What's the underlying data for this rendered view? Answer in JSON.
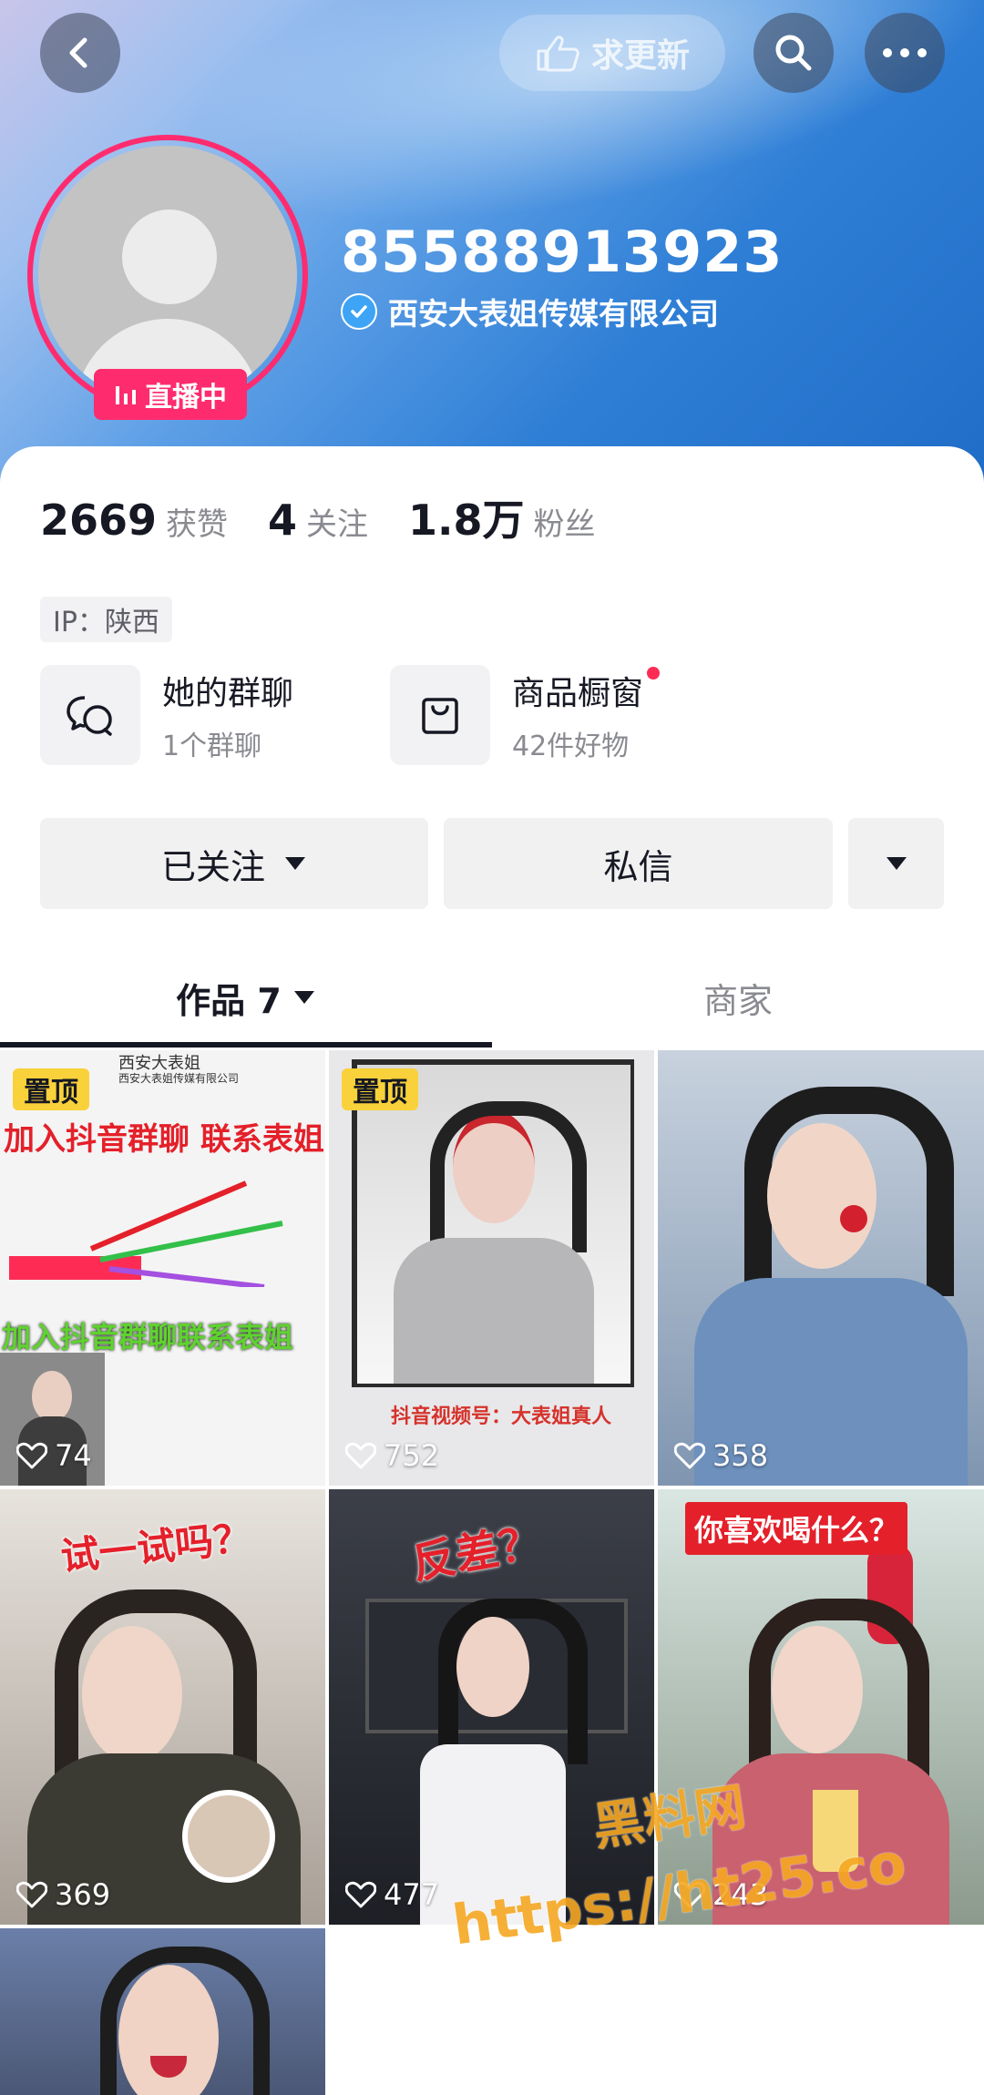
{
  "header": {
    "update_label": "求更新",
    "username": "85588913923",
    "company": "西安大表姐传媒有限公司",
    "live_label": "直播中"
  },
  "stats": [
    {
      "num": "2669",
      "label": "获赞"
    },
    {
      "num": "4",
      "label": "关注"
    },
    {
      "num": "1.8万",
      "label": "粉丝"
    }
  ],
  "ip": "IP：陕西",
  "features": {
    "group": {
      "title": "她的群聊",
      "sub": "1个群聊"
    },
    "shop": {
      "title": "商品橱窗",
      "sub": "42件好物"
    }
  },
  "actions": {
    "followed": "已关注",
    "message": "私信"
  },
  "tabs": {
    "works": "作品 7",
    "merchant": "商家"
  },
  "videos": [
    {
      "pinned": "置顶",
      "likes": "74",
      "caption_top": "加入抖音群聊 联系表姐",
      "caption_bottom": "加入抖音群聊联系表姐",
      "header_name": "西安大表姐",
      "header_company": "西安大表姐传媒有限公司"
    },
    {
      "pinned": "置顶",
      "likes": "752",
      "caption": "抖音视频号：大表姐真人"
    },
    {
      "likes": "358"
    },
    {
      "likes": "369",
      "caption": "试一试吗？"
    },
    {
      "likes": "477",
      "caption": "反差？"
    },
    {
      "likes": "243",
      "caption": "你喜欢喝什么？"
    },
    {}
  ],
  "watermark": {
    "line1": "黑料网",
    "line2": "https://ht25.co"
  },
  "colors": {
    "accent": "#fe2c6f",
    "verify": "#3ea4f5",
    "pin": "#f9d13a"
  }
}
